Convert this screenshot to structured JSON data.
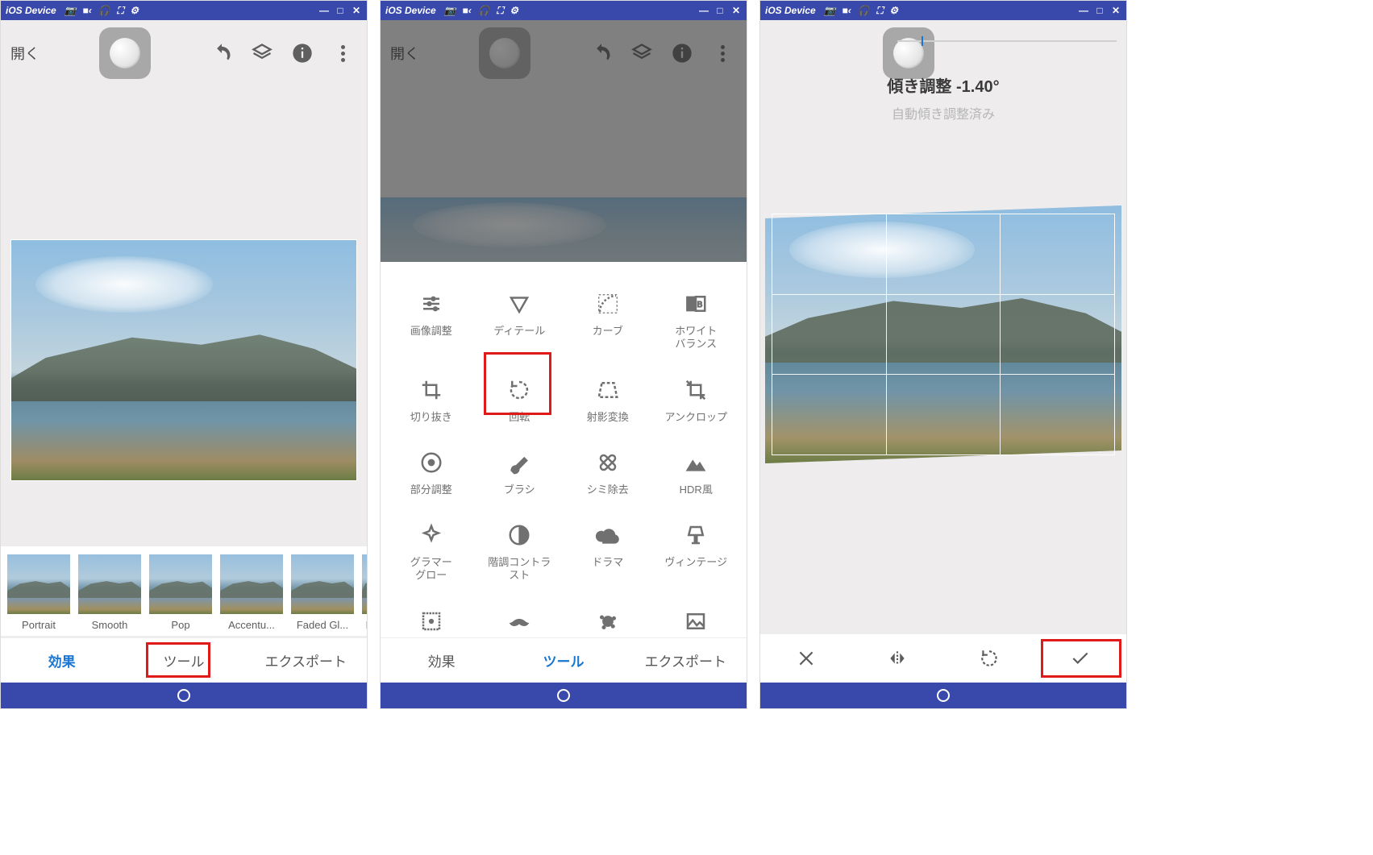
{
  "titlebar": {
    "device_label": "iOS Device",
    "icons": [
      "camera-icon",
      "video-icon",
      "headphones-icon",
      "fullscreen-icon",
      "gear-icon"
    ]
  },
  "screen1": {
    "open_label": "開く",
    "thumbnails": [
      {
        "label": "Portrait"
      },
      {
        "label": "Smooth"
      },
      {
        "label": "Pop"
      },
      {
        "label": "Accentu..."
      },
      {
        "label": "Faded Gl..."
      },
      {
        "label": "M"
      }
    ],
    "tabs": {
      "effects": "効果",
      "tools": "ツール",
      "export": "エクスポート"
    },
    "highlighted_tab": "tools"
  },
  "screen2": {
    "open_label": "開く",
    "tools": [
      [
        {
          "id": "tune-image",
          "label": "画像調整"
        },
        {
          "id": "details",
          "label": "ディテール"
        },
        {
          "id": "curves",
          "label": "カーブ"
        },
        {
          "id": "white-balance",
          "label": "ホワイト\nバランス"
        }
      ],
      [
        {
          "id": "crop",
          "label": "切り抜き"
        },
        {
          "id": "rotate",
          "label": "回転"
        },
        {
          "id": "perspective",
          "label": "射影変換"
        },
        {
          "id": "uncrop",
          "label": "アンクロップ"
        }
      ],
      [
        {
          "id": "selective",
          "label": "部分調整"
        },
        {
          "id": "brush",
          "label": "ブラシ"
        },
        {
          "id": "healing",
          "label": "シミ除去"
        },
        {
          "id": "hdr",
          "label": "HDR風"
        }
      ],
      [
        {
          "id": "glamour-glow",
          "label": "グラマー\nグロー"
        },
        {
          "id": "tonal-contrast",
          "label": "階調コントラ\nスト"
        },
        {
          "id": "drama",
          "label": "ドラマ"
        },
        {
          "id": "vintage",
          "label": "ヴィンテージ"
        }
      ],
      [
        {
          "id": "grainy-film",
          "label": ""
        },
        {
          "id": "retrolux",
          "label": ""
        },
        {
          "id": "grunge",
          "label": ""
        },
        {
          "id": "bw",
          "label": ""
        }
      ]
    ],
    "highlighted_tool": "rotate",
    "tabs": {
      "effects": "効果",
      "tools": "ツール",
      "export": "エクスポート"
    },
    "active_tab": "tools"
  },
  "screen3": {
    "title": "傾き調整 -1.40°",
    "subtitle": "自動傾き調整済み",
    "actions": [
      "cancel",
      "flip",
      "rotate",
      "confirm"
    ],
    "highlighted_action": "confirm"
  },
  "colors": {
    "titlebar_bg": "#3949ab",
    "accent": "#1976d2",
    "highlight_box": "#e01919"
  }
}
